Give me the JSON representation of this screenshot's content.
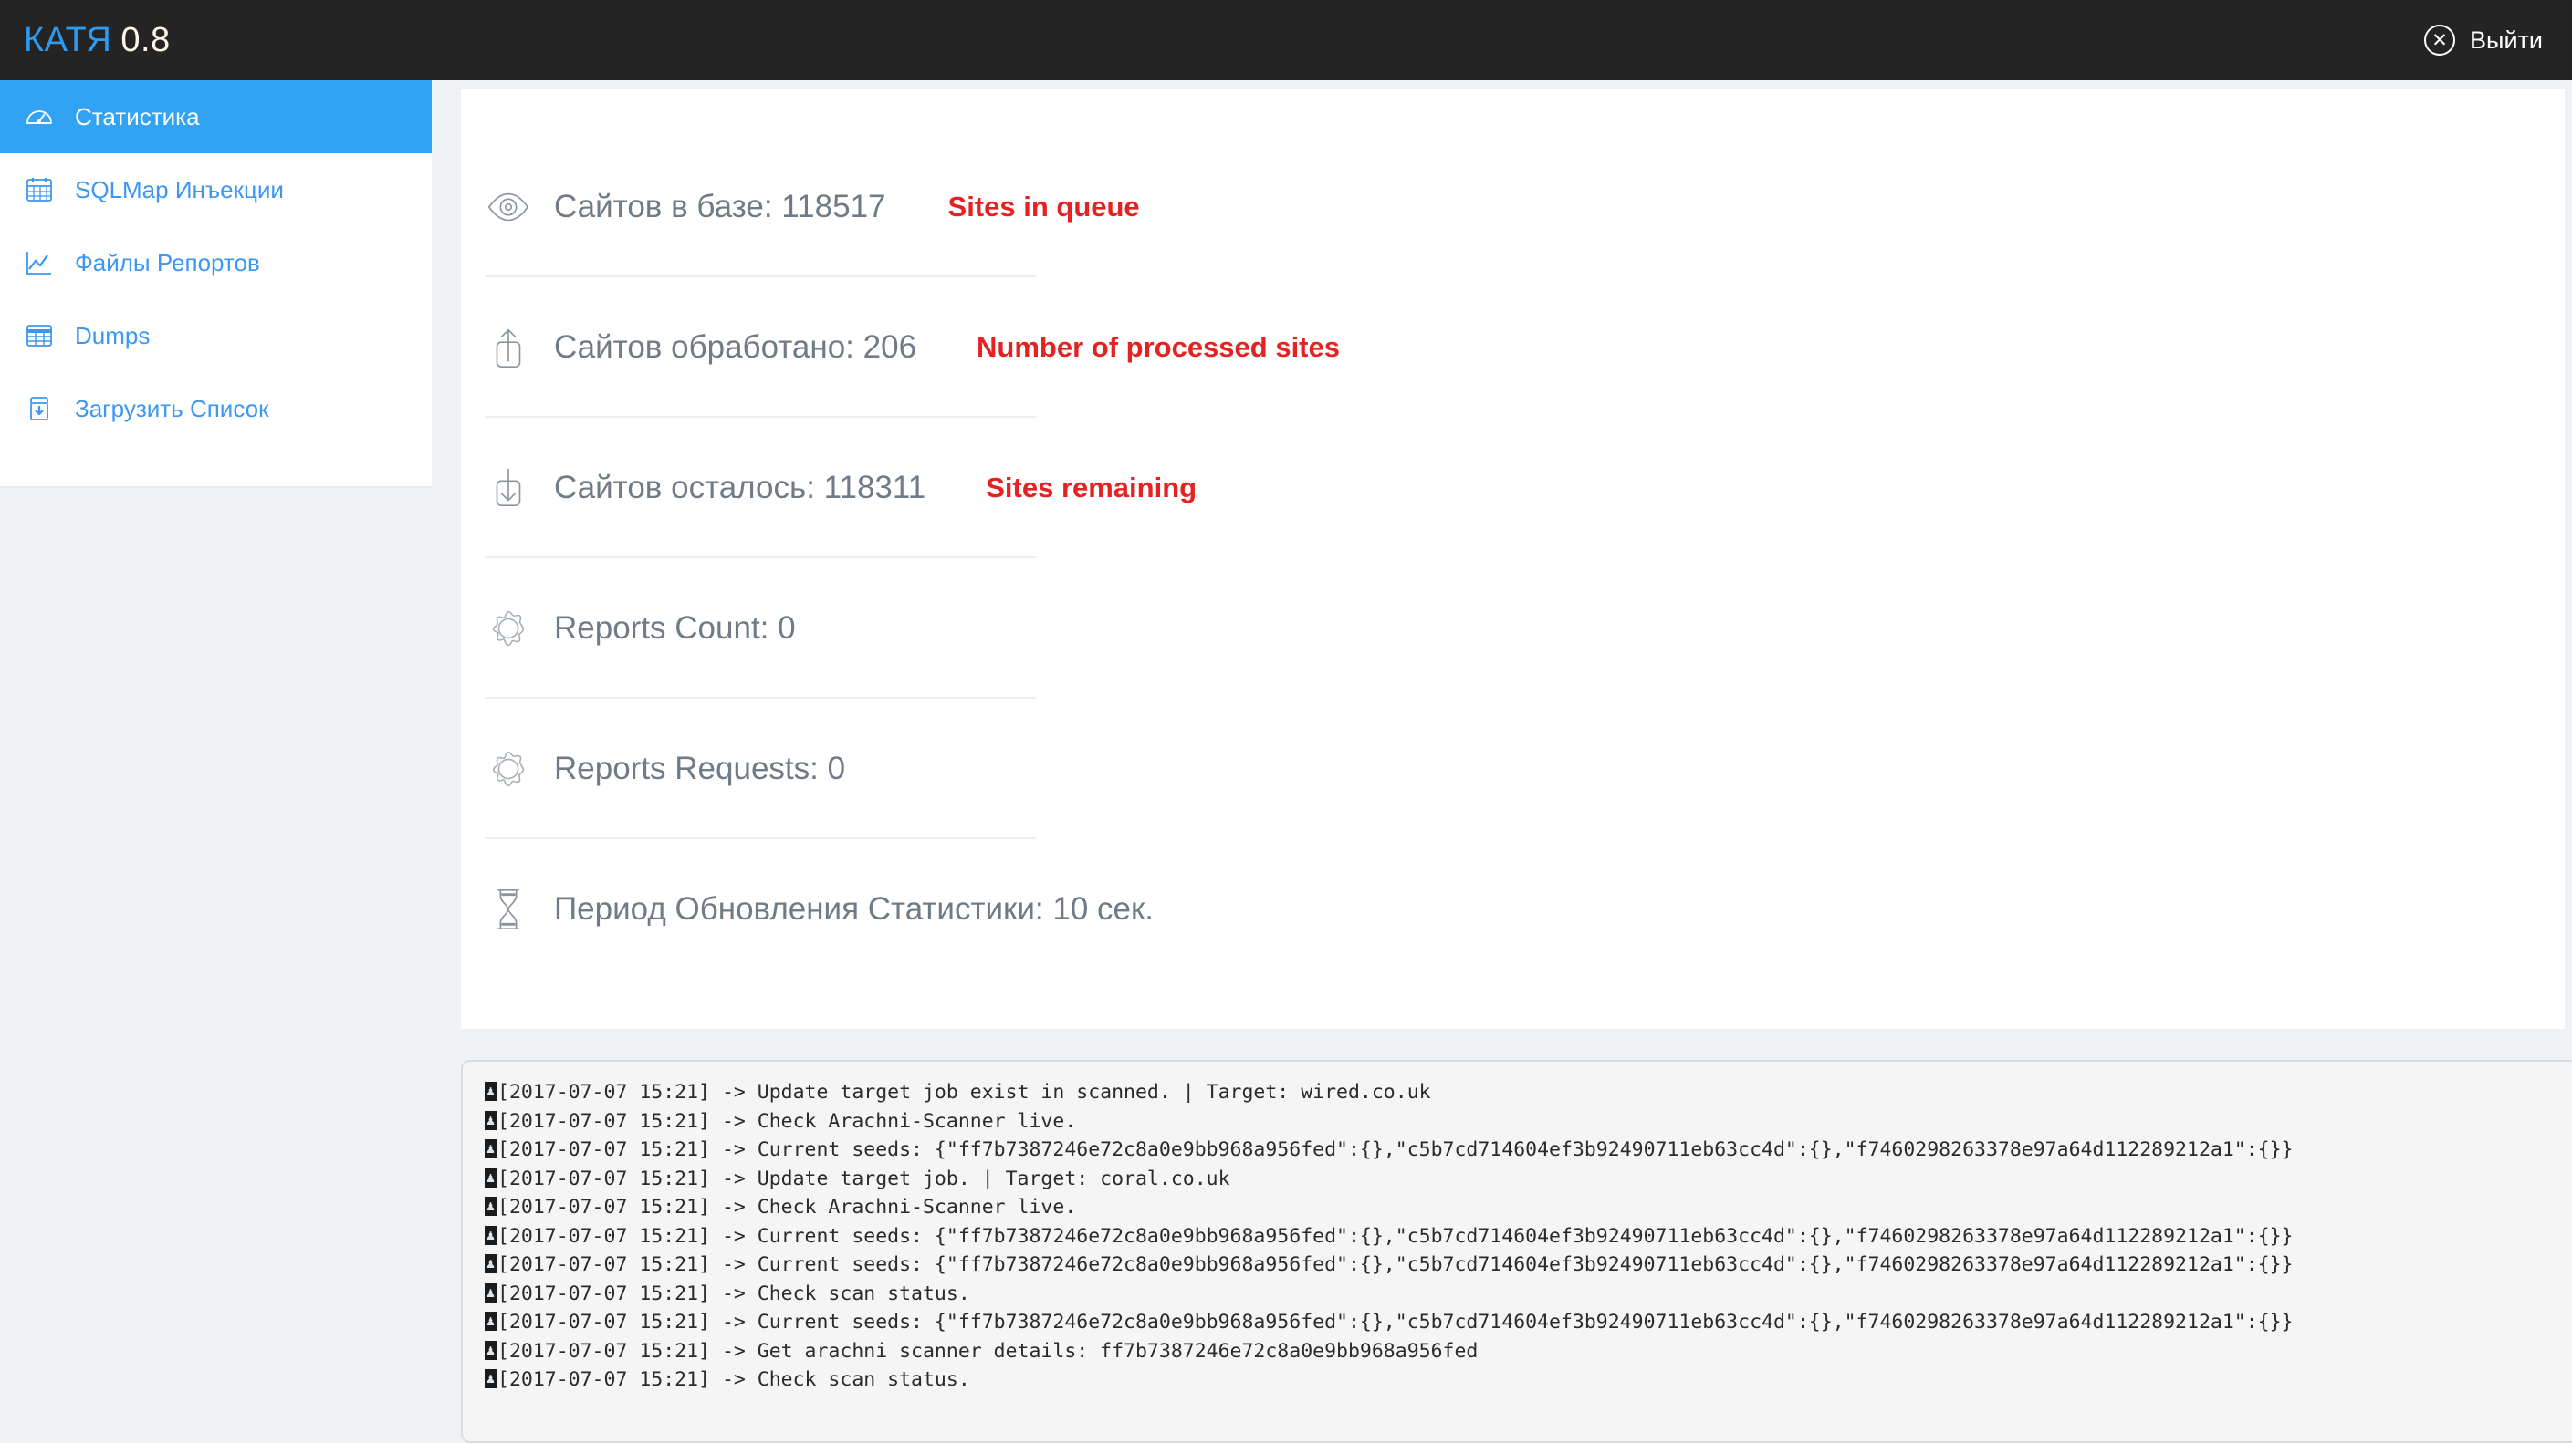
{
  "topbar": {
    "brand_name": "КАТЯ",
    "brand_version": "0.8",
    "logout_label": "Выйти",
    "logout_icon": "circle-x-icon",
    "background": "#242424",
    "brand_color": "#2e9bf0"
  },
  "sidebar": {
    "active_color": "#32a2f5",
    "link_color": "#3c97f3",
    "items": [
      {
        "label": "Статистика",
        "icon": "dashboard-gauge-icon",
        "active": true
      },
      {
        "label": "SQLMap Инъекции",
        "icon": "grid-table-icon",
        "active": false
      },
      {
        "label": "Файлы Репортов",
        "icon": "chart-line-icon",
        "active": false
      },
      {
        "label": "Dumps",
        "icon": "table-icon",
        "active": false
      },
      {
        "label": "Загрузить Список",
        "icon": "upload-box-icon",
        "active": false
      }
    ]
  },
  "stats": {
    "note_color": "#e52222",
    "rows": [
      {
        "icon": "eye-icon",
        "text": "Сайтов в базе: 118517",
        "note": "Sites in queue"
      },
      {
        "icon": "upload-icon",
        "text": "Сайтов обработано: 206",
        "note": "Number of processed sites"
      },
      {
        "icon": "download-icon",
        "text": "Сайтов осталось: 118311",
        "note": "Sites remaining"
      },
      {
        "icon": "gear-icon",
        "text": "Reports Count: 0",
        "note": ""
      },
      {
        "icon": "gear-icon",
        "text": "Reports Requests: 0",
        "note": ""
      },
      {
        "icon": "hourglass-icon",
        "text": "Период Обновления Статистики: 10 сек.",
        "note": ""
      }
    ]
  },
  "log": {
    "lines": [
      "[2017-07-07 15:21] -> Update target job exist in scanned. | Target: wired.co.uk",
      "[2017-07-07 15:21] -> Check Arachni-Scanner live.",
      "[2017-07-07 15:21] -> Current seeds: {\"ff7b7387246e72c8a0e9bb968a956fed\":{},\"c5b7cd714604ef3b92490711eb63cc4d\":{},\"f7460298263378e97a64d112289212a1\":{}}",
      "[2017-07-07 15:21] -> Update target job. | Target: coral.co.uk",
      "[2017-07-07 15:21] -> Check Arachni-Scanner live.",
      "[2017-07-07 15:21] -> Current seeds: {\"ff7b7387246e72c8a0e9bb968a956fed\":{},\"c5b7cd714604ef3b92490711eb63cc4d\":{},\"f7460298263378e97a64d112289212a1\":{}}",
      "[2017-07-07 15:21] -> Current seeds: {\"ff7b7387246e72c8a0e9bb968a956fed\":{},\"c5b7cd714604ef3b92490711eb63cc4d\":{},\"f7460298263378e97a64d112289212a1\":{}}",
      "[2017-07-07 15:21] -> Check scan status.",
      "[2017-07-07 15:21] -> Current seeds: {\"ff7b7387246e72c8a0e9bb968a956fed\":{},\"c5b7cd714604ef3b92490711eb63cc4d\":{},\"f7460298263378e97a64d112289212a1\":{}}",
      "[2017-07-07 15:21] -> Get arachni scanner details: ff7b7387246e72c8a0e9bb968a956fed",
      "[2017-07-07 15:21] -> Check scan status."
    ]
  }
}
